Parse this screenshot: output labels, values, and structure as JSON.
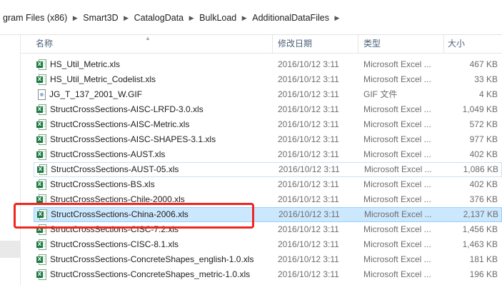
{
  "breadcrumb": {
    "items": [
      "gram Files (x86)",
      "Smart3D",
      "CatalogData",
      "BulkLoad",
      "AdditionalDataFiles"
    ]
  },
  "columns": {
    "name": "名称",
    "date": "修改日期",
    "type": "类型",
    "size": "大小"
  },
  "files": [
    {
      "name": "HS_Util_Metric.xls",
      "date": "2016/10/12 3:11",
      "type": "Microsoft Excel ...",
      "size": "467 KB",
      "icon": "excel-file-icon"
    },
    {
      "name": "HS_Util_Metric_Codelist.xls",
      "date": "2016/10/12 3:11",
      "type": "Microsoft Excel ...",
      "size": "33 KB",
      "icon": "excel-file-icon"
    },
    {
      "name": "JG_T_137_2001_W.GIF",
      "date": "2016/10/12 3:11",
      "type": "GIF 文件",
      "size": "4 KB",
      "icon": "image-file-icon"
    },
    {
      "name": "StructCrossSections-AISC-LRFD-3.0.xls",
      "date": "2016/10/12 3:11",
      "type": "Microsoft Excel ...",
      "size": "1,049 KB",
      "icon": "excel-file-icon"
    },
    {
      "name": "StructCrossSections-AISC-Metric.xls",
      "date": "2016/10/12 3:11",
      "type": "Microsoft Excel ...",
      "size": "572 KB",
      "icon": "excel-file-icon"
    },
    {
      "name": "StructCrossSections-AISC-SHAPES-3.1.xls",
      "date": "2016/10/12 3:11",
      "type": "Microsoft Excel ...",
      "size": "977 KB",
      "icon": "excel-file-icon"
    },
    {
      "name": "StructCrossSections-AUST.xls",
      "date": "2016/10/12 3:11",
      "type": "Microsoft Excel ...",
      "size": "402 KB",
      "icon": "excel-file-icon"
    },
    {
      "name": "StructCrossSections-AUST-05.xls",
      "date": "2016/10/12 3:11",
      "type": "Microsoft Excel ...",
      "size": "1,086 KB",
      "icon": "excel-file-icon"
    },
    {
      "name": "StructCrossSections-BS.xls",
      "date": "2016/10/12 3:11",
      "type": "Microsoft Excel ...",
      "size": "402 KB",
      "icon": "excel-file-icon"
    },
    {
      "name": "StructCrossSections-Chile-2000.xls",
      "date": "2016/10/12 3:11",
      "type": "Microsoft Excel ...",
      "size": "376 KB",
      "icon": "excel-file-icon"
    },
    {
      "name": "StructCrossSections-China-2006.xls",
      "date": "2016/10/12 3:11",
      "type": "Microsoft Excel ...",
      "size": "2,137 KB",
      "icon": "excel-file-icon"
    },
    {
      "name": "StructCrossSections-CISC-7.2.xls",
      "date": "2016/10/12 3:11",
      "type": "Microsoft Excel ...",
      "size": "1,456 KB",
      "icon": "excel-file-icon"
    },
    {
      "name": "StructCrossSections-CISC-8.1.xls",
      "date": "2016/10/12 3:11",
      "type": "Microsoft Excel ...",
      "size": "1,463 KB",
      "icon": "excel-file-icon"
    },
    {
      "name": "StructCrossSections-ConcreteShapes_english-1.0.xls",
      "date": "2016/10/12 3:11",
      "type": "Microsoft Excel ...",
      "size": "181 KB",
      "icon": "excel-file-icon"
    },
    {
      "name": "StructCrossSections-ConcreteShapes_metric-1.0.xls",
      "date": "2016/10/12 3:11",
      "type": "Microsoft Excel ...",
      "size": "196 KB",
      "icon": "excel-file-icon"
    }
  ],
  "selected_file": "StructCrossSections-China-2006.xls",
  "colors": {
    "selection_bg": "#cce8ff",
    "selection_border": "#99d1ff",
    "highlight_box": "#f0261f",
    "header_text": "#4c607a"
  }
}
